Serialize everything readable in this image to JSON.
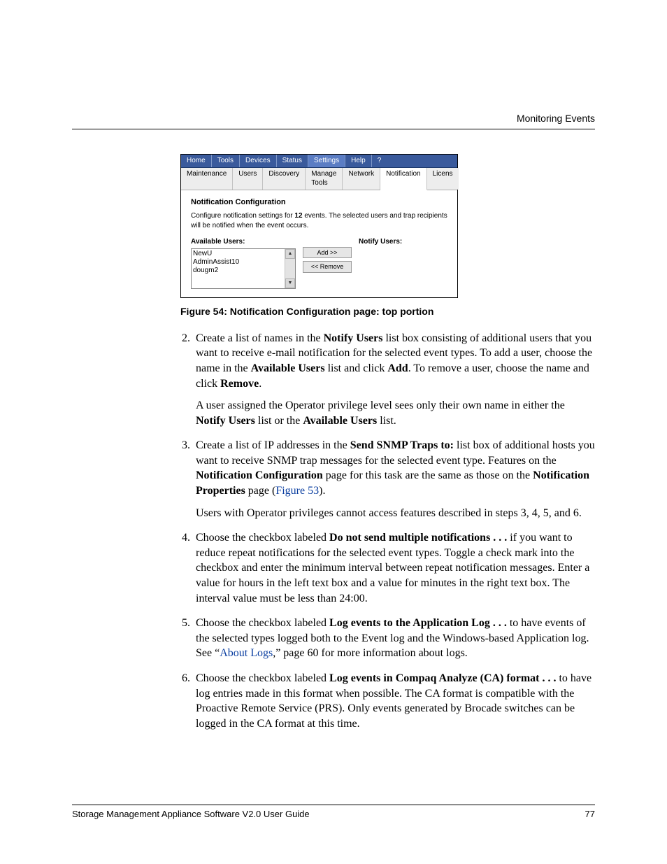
{
  "header": {
    "section_title": "Monitoring Events"
  },
  "figure": {
    "tabs_primary": [
      "Home",
      "Tools",
      "Devices",
      "Status",
      "Settings",
      "Help",
      "?"
    ],
    "tabs_primary_active": "Settings",
    "tabs_secondary": [
      "Maintenance",
      "Users",
      "Discovery",
      "Manage Tools",
      "Network",
      "Notification",
      "Licens"
    ],
    "tabs_secondary_active": "Notification",
    "title": "Notification Configuration",
    "desc_before": "Configure notification settings for ",
    "desc_bold": "12",
    "desc_after": " events. The selected users and trap recipients will be notified when the event occurs.",
    "available_label": "Available Users:",
    "notify_label": "Notify Users:",
    "available_users": [
      "NewU",
      "AdminAssist10",
      "dougm2"
    ],
    "btn_add": "Add >>",
    "btn_remove": "<< Remove",
    "caption": "Figure 54:  Notification Configuration page: top portion"
  },
  "steps": {
    "s2": {
      "t1": "Create a list of names in the ",
      "b1": "Notify Users",
      "t2": " list box consisting of additional users that you want to receive e-mail notification for the selected event types. To add a user, choose the name in the ",
      "b2": "Available Users",
      "t3": " list and click ",
      "b3": "Add",
      "t4": ". To remove a user, choose the name and click ",
      "b4": "Remove",
      "t5": ".",
      "p2a": "A user assigned the Operator privilege level sees only their own name in either the ",
      "p2b1": "Notify Users",
      "p2b": " list or the ",
      "p2b2": "Available Users",
      "p2c": " list."
    },
    "s3": {
      "t1": "Create a list of IP addresses in the ",
      "b1": "Send SNMP Traps to:",
      "t2": " list box of additional hosts you want to receive SNMP trap messages for the selected event type. Features on the ",
      "b2": "Notification Configuration",
      "t3": " page for this task are the same as those on the ",
      "b3": "Notification Properties",
      "t4": " page (",
      "link": "Figure 53",
      "t5": ").",
      "p2": "Users with Operator privileges cannot access features described in steps 3, 4, 5, and 6."
    },
    "s4": {
      "t1": "Choose the checkbox labeled ",
      "b1": "Do not send multiple notifications . . . ",
      "t2": "if you want to reduce repeat notifications for the selected event types. Toggle a check mark into the checkbox and enter the minimum interval between repeat notification messages. Enter a value for hours in the left text box and a value for minutes in the right text box. The interval value must be less than 24:00."
    },
    "s5": {
      "t1": "Choose the checkbox labeled ",
      "b1": "Log events to the Application Log . . . ",
      "t2": "to have events of the selected types logged both to the Event log and the Windows-based Application log. See “",
      "link": "About Logs",
      "t3": ",” page 60 for more information about logs."
    },
    "s6": {
      "t1": "Choose the checkbox labeled ",
      "b1": "Log events in Compaq Analyze (CA) format . . . ",
      "t2": "to have log entries made in this format when possible. The CA format is compatible with the Proactive Remote Service (PRS). Only events generated by Brocade switches can be logged in the CA format at this time."
    }
  },
  "footer": {
    "left": "Storage Management Appliance Software V2.0 User Guide",
    "right": "77"
  }
}
